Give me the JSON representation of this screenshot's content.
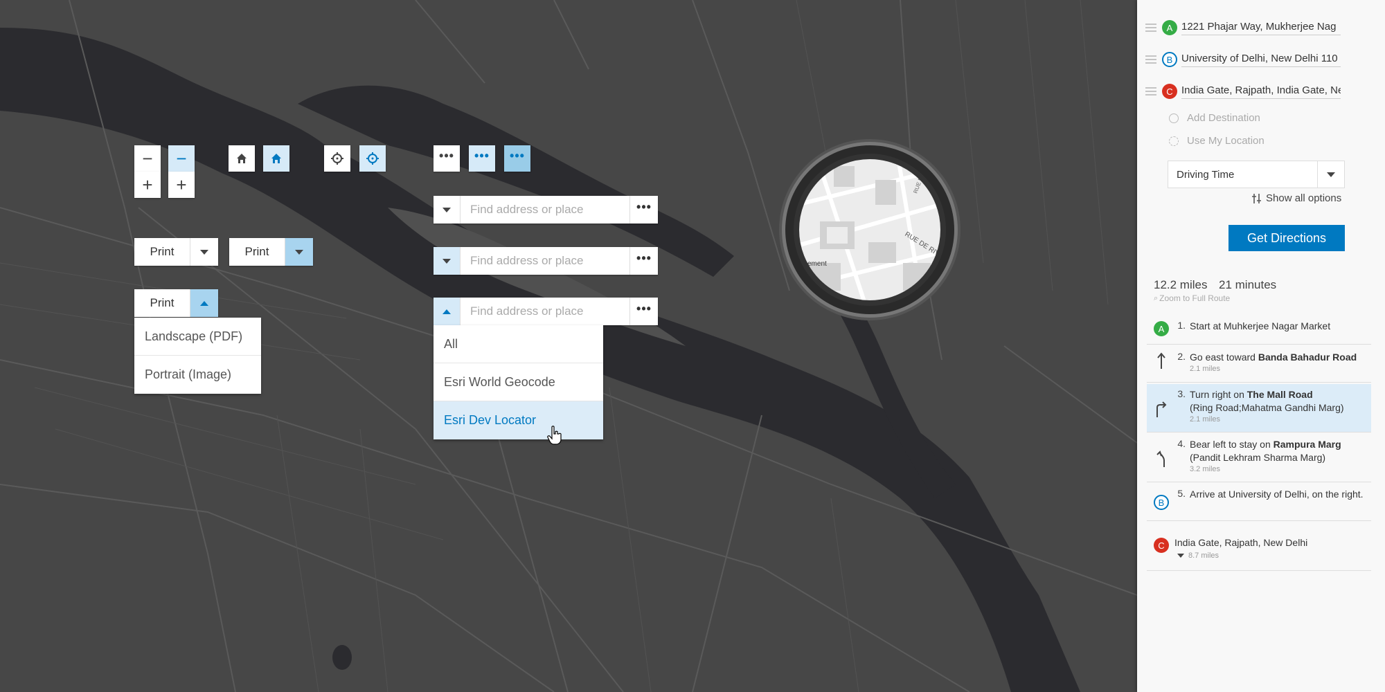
{
  "map": {
    "colors": {
      "land": "#474747",
      "water": "#2b2b2f",
      "roads": "#5c5c5c"
    },
    "zoom_buttons": {
      "minus": "−",
      "plus": "+"
    },
    "button_icons": [
      "home-icon",
      "locate-icon",
      "ellipsis-icon"
    ],
    "ellipsis": "•••"
  },
  "print_widgets": [
    {
      "label": "Print"
    },
    {
      "label": "Print"
    },
    {
      "label": "Print"
    }
  ],
  "print_menu": {
    "items": [
      "Landscape (PDF)",
      "Portrait (Image)"
    ]
  },
  "search_widgets": [
    {
      "placeholder": "Find address or place"
    },
    {
      "placeholder": "Find address or place"
    },
    {
      "placeholder": "Find address or place"
    }
  ],
  "source_menu": {
    "items": [
      "All",
      "Esri World Geocode",
      "Esri Dev Locator"
    ],
    "selected": "Esri Dev Locator"
  },
  "directions": {
    "stops": [
      {
        "marker": "A",
        "value": "1221 Phajar Way, Mukherjee Nag",
        "color": "#35ac46"
      },
      {
        "marker": "B",
        "value": "University of Delhi, New Delhi 110",
        "color": "#0079c1"
      },
      {
        "marker": "C",
        "value": "India Gate, Rajpath, India Gate, Ne",
        "color": "#d83020"
      }
    ],
    "add_destination": "Add Destination",
    "use_my_location": "Use My Location",
    "travel_mode": "Driving Time",
    "show_all_options": "Show all options",
    "get_directions": "Get Directions",
    "summary": {
      "distance": "12.2 miles",
      "time": "21 minutes",
      "zoom": "Zoom to Full Route"
    },
    "steps": [
      {
        "num": "1.",
        "pre": "Start at Muhkerjee Nagar Market",
        "bold": "",
        "post": "",
        "dist": ""
      },
      {
        "num": "2.",
        "pre": "Go east toward ",
        "bold": "Banda Bahadur Road",
        "post": "",
        "dist": "2.1 miles"
      },
      {
        "num": "3.",
        "pre": "Turn right on ",
        "bold": "The Mall Road",
        "post": "(Ring Road;Mahatma Gandhi Marg)",
        "dist": "2.1 miles"
      },
      {
        "num": "4.",
        "pre": "Bear left to stay on ",
        "bold": "Rampura Marg",
        "post": "(Pandit Lekhram Sharma Marg)",
        "dist": "3.2 miles"
      },
      {
        "num": "5.",
        "pre": "Arrive at University of Delhi, on the right.",
        "bold": "",
        "post": "",
        "dist": ""
      }
    ],
    "next_leg": {
      "marker": "C",
      "label": "India Gate, Rajpath, New Delhi",
      "dist": "8.7 miles"
    }
  },
  "magnifier": {
    "labels": [
      "RUE DE RIVO",
      "ssement",
      "RUE DU VIEUX"
    ]
  }
}
